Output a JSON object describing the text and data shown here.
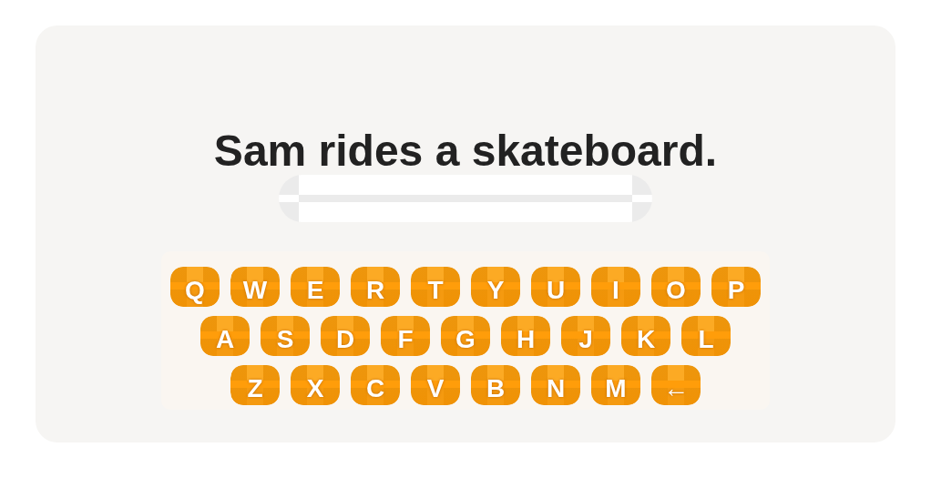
{
  "prompt": {
    "sentence": "Sam rides a skateboard."
  },
  "keyboard": {
    "rows": [
      [
        "Q",
        "W",
        "E",
        "R",
        "T",
        "Y",
        "U",
        "I",
        "O",
        "P"
      ],
      [
        "A",
        "S",
        "D",
        "F",
        "G",
        "H",
        "J",
        "K",
        "L"
      ],
      [
        "Z",
        "X",
        "C",
        "V",
        "B",
        "N",
        "M",
        "←"
      ]
    ]
  }
}
